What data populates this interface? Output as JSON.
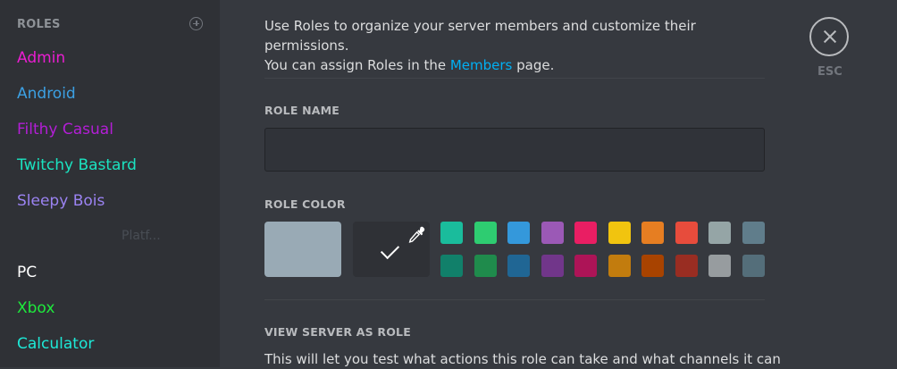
{
  "sidebar": {
    "header": "ROLES",
    "ghost_label": "Platf...",
    "roles": [
      {
        "label": "Admin",
        "color": "#e91ed0"
      },
      {
        "label": "Android",
        "color": "#3ca0e3"
      },
      {
        "label": "Filthy Casual",
        "color": "#b31ed6"
      },
      {
        "label": "Twitchy Bastard",
        "color": "#1be3c0"
      },
      {
        "label": "Sleepy Bois",
        "color": "#9b83f2"
      },
      {
        "label": "PC",
        "color": "#ffffff"
      },
      {
        "label": "Xbox",
        "color": "#1eea3c"
      },
      {
        "label": "Calculator",
        "color": "#1de9d7"
      }
    ]
  },
  "main": {
    "intro_line1": "Use Roles to organize your server members and customize their permissions.",
    "intro_line2_before": "You can assign Roles in the ",
    "intro_link": "Members",
    "intro_line2_after": " page.",
    "role_name_label": "ROLE NAME",
    "role_name_value": "",
    "role_color_label": "ROLE COLOR",
    "default_color": "#99aab5",
    "view_as_role_label": "VIEW SERVER AS ROLE",
    "view_as_role_desc": "This will let you test what actions this role can take and what channels it can"
  },
  "colors": {
    "row1": [
      "#1abc9c",
      "#2ecc71",
      "#3498db",
      "#9b59b6",
      "#e91e63",
      "#f1c40f",
      "#e67e22",
      "#e74c3c",
      "#95a5a6",
      "#607d8b"
    ],
    "row2": [
      "#11806a",
      "#1f8b4c",
      "#206694",
      "#71368a",
      "#ad1457",
      "#c27c0e",
      "#a84300",
      "#992d22",
      "#979c9f",
      "#546e7a"
    ]
  },
  "close": {
    "label": "ESC"
  }
}
